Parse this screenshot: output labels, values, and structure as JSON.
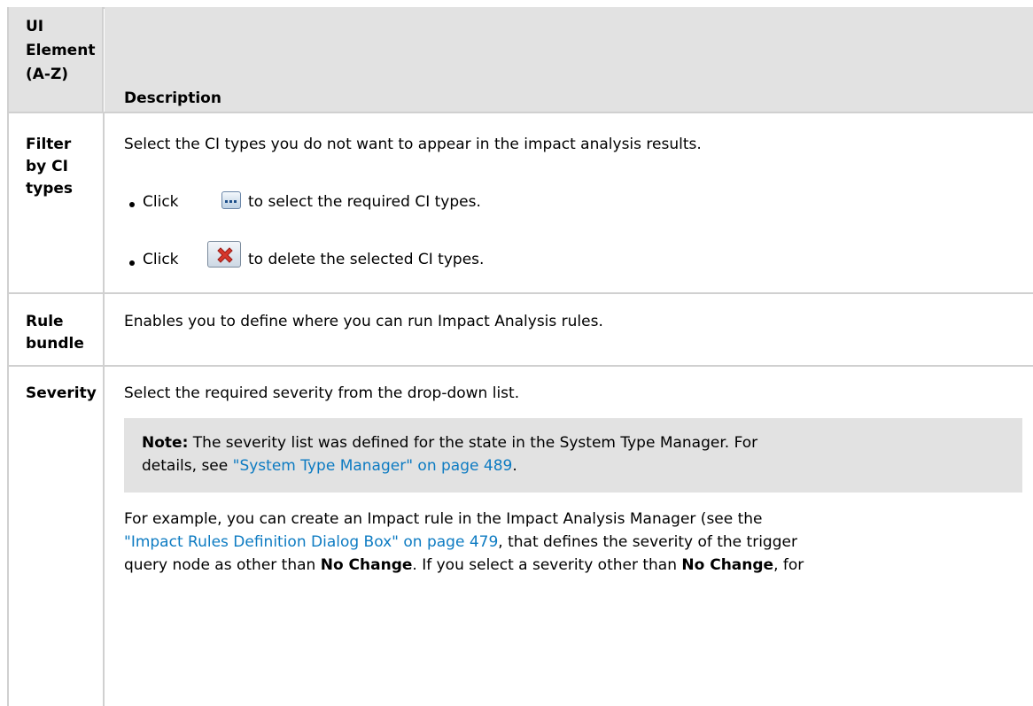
{
  "header": {
    "col1_line1": "UI",
    "col1_line2": "Element",
    "col1_line3": "(A-Z)",
    "col2": "Description"
  },
  "rows": {
    "filter": {
      "label_line1": "Filter",
      "label_line2": "by CI",
      "label_line3": "types",
      "description": "Select the CI types you do not want to appear in the impact analysis results.",
      "bullet1_pre": "Click",
      "bullet1_post": "to select the required CI types.",
      "bullet2_pre": "Click",
      "bullet2_post": "to delete the selected CI types."
    },
    "rule_bundle": {
      "label_line1": "Rule",
      "label_line2": "bundle",
      "description": "Enables you to define where you can run Impact Analysis rules."
    },
    "severity": {
      "label": "Severity",
      "description": "Select the required severity from the drop-down list.",
      "note_label": "Note:",
      "note_text1": "The severity list was defined for the state in the System Type Manager. For",
      "note_text2_pre": "details, see ",
      "note_link": "\"System Type Manager\" on page 489",
      "note_text2_post": ".",
      "example_line1": "For example, you can create an Impact rule in the Impact Analysis Manager (see the",
      "example_link": "\"Impact Rules Definition Dialog Box\" on page 479",
      "example_line2_post": ", that defines the severity of the trigger",
      "example_line3_pre": "query node as other than ",
      "example_bold1": "No Change",
      "example_line3_mid": ". If you select a severity other than ",
      "example_bold2": "No Change",
      "example_line3_post": ", for"
    }
  },
  "icons": {
    "ellipsis_button": "ellipsis-icon",
    "delete_button": "delete-icon"
  },
  "colors": {
    "header_bg": "#e2e2e2",
    "link": "#0d7bc2",
    "delete_red": "#d6372c"
  }
}
